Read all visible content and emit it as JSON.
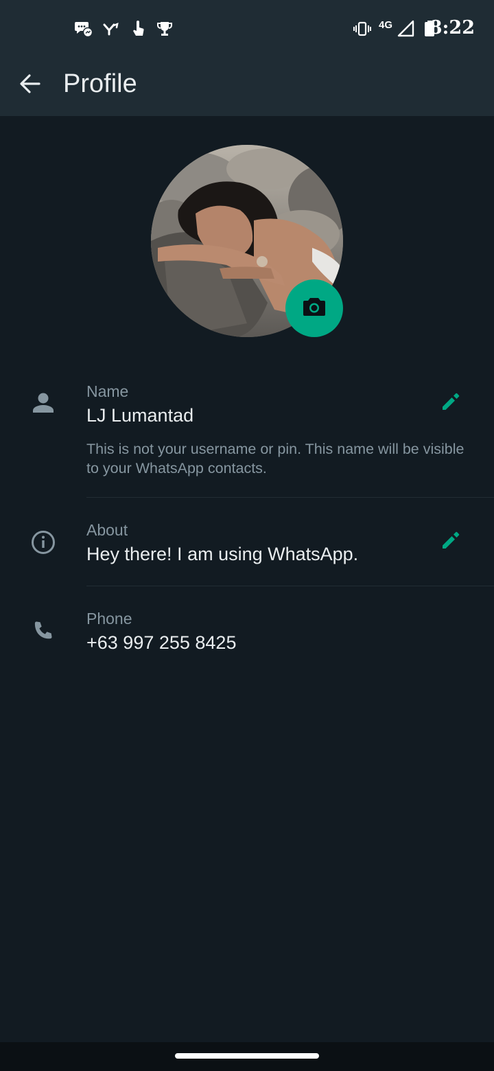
{
  "status_bar": {
    "time": "8:22",
    "network": "4G",
    "notification_icons": [
      "messenger-icon",
      "app-y-icon",
      "tap-hand-icon",
      "trophy-icon"
    ],
    "system_icons": [
      "vibrate-icon",
      "signal-icon",
      "battery-icon"
    ]
  },
  "app_bar": {
    "title": "Profile",
    "back_icon": "arrow-left-icon"
  },
  "profile": {
    "camera_icon": "camera-icon",
    "name": {
      "label": "Name",
      "value": "LJ Lumantad",
      "hint": "This is not your username or pin. This name will be visible to your WhatsApp contacts.",
      "icon": "person-icon",
      "edit_icon": "pencil-icon"
    },
    "about": {
      "label": "About",
      "value": "Hey there! I am using WhatsApp.",
      "icon": "info-icon",
      "edit_icon": "pencil-icon"
    },
    "phone": {
      "label": "Phone",
      "value": "+63 997 255 8425",
      "icon": "phone-icon"
    }
  },
  "colors": {
    "background": "#121b22",
    "bar": "#1f2c34",
    "accent": "#00a884",
    "primary_text": "#e9edef",
    "secondary_text": "#8696a0",
    "divider": "#222d34"
  }
}
